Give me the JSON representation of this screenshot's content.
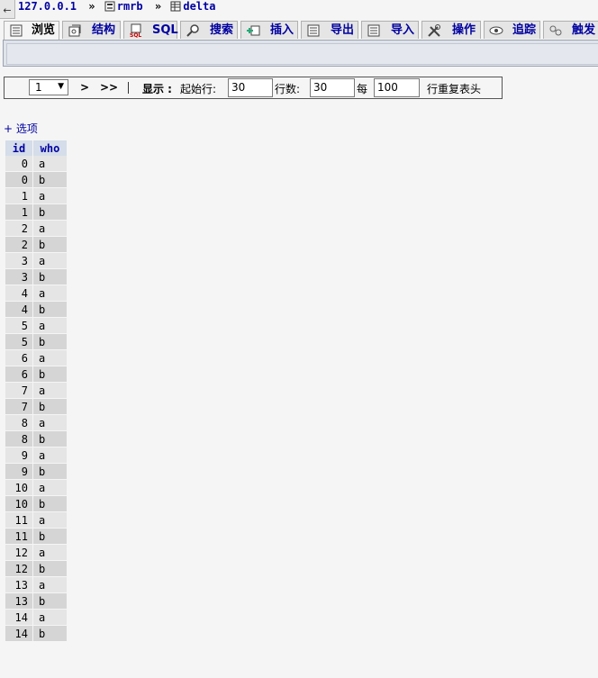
{
  "breadcrumb": {
    "back": "←",
    "server": "127.0.0.1",
    "separator": "»",
    "database": "rmrb",
    "table": "delta"
  },
  "tabs": [
    {
      "label": "浏览",
      "icon": "browse-icon",
      "active": true
    },
    {
      "label": "结构",
      "icon": "structure-icon"
    },
    {
      "label": "SQL",
      "icon": "sql-icon"
    },
    {
      "label": "搜索",
      "icon": "search-icon"
    },
    {
      "label": "插入",
      "icon": "insert-icon"
    },
    {
      "label": "导出",
      "icon": "export-icon"
    },
    {
      "label": "导入",
      "icon": "import-icon"
    },
    {
      "label": "操作",
      "icon": "operations-icon"
    },
    {
      "label": "追踪",
      "icon": "tracking-icon"
    },
    {
      "label": "触发",
      "icon": "triggers-icon"
    }
  ],
  "navigation": {
    "page_value": "1",
    "next": ">",
    "last": ">>",
    "show_label": "显示 :",
    "start_row_label": "起始行:",
    "start_row_value": "30",
    "rows_label": "行数:",
    "rows_value": "30",
    "every_label": "每",
    "repeat_value": "100",
    "repeat_label": "行重复表头"
  },
  "options_link": "+ 选项",
  "table": {
    "columns": [
      "id",
      "who"
    ],
    "rows": [
      [
        "0",
        "a"
      ],
      [
        "0",
        "b"
      ],
      [
        "1",
        "a"
      ],
      [
        "1",
        "b"
      ],
      [
        "2",
        "a"
      ],
      [
        "2",
        "b"
      ],
      [
        "3",
        "a"
      ],
      [
        "3",
        "b"
      ],
      [
        "4",
        "a"
      ],
      [
        "4",
        "b"
      ],
      [
        "5",
        "a"
      ],
      [
        "5",
        "b"
      ],
      [
        "6",
        "a"
      ],
      [
        "6",
        "b"
      ],
      [
        "7",
        "a"
      ],
      [
        "7",
        "b"
      ],
      [
        "8",
        "a"
      ],
      [
        "8",
        "b"
      ],
      [
        "9",
        "a"
      ],
      [
        "9",
        "b"
      ],
      [
        "10",
        "a"
      ],
      [
        "10",
        "b"
      ],
      [
        "11",
        "a"
      ],
      [
        "11",
        "b"
      ],
      [
        "12",
        "a"
      ],
      [
        "12",
        "b"
      ],
      [
        "13",
        "a"
      ],
      [
        "13",
        "b"
      ],
      [
        "14",
        "a"
      ],
      [
        "14",
        "b"
      ]
    ]
  }
}
